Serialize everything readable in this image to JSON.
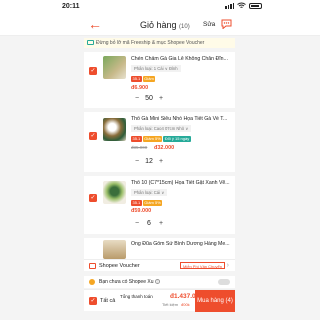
{
  "status_bar": {
    "time": "20:11"
  },
  "header": {
    "title": "Giỏ hàng",
    "count": "(10)",
    "edit_label": "Sửa"
  },
  "banner": {
    "text": "Đừng bỏ lỡ mã Freeship & mục Shopee Voucher"
  },
  "items": [
    {
      "name": "Chén Chấm Gà Gia Lê Không Chân Đĩn...",
      "variant": "Phân loại: 1 Cái ∨ Đỉnh",
      "old_price": "",
      "price": "đ6.900",
      "quantity": "50",
      "badges": []
    },
    {
      "name": "Thố Gà Mini Siêu Nhỏ Họa Tiết Gà Về T...",
      "variant": "Phân loại: Cao4 07cm Nhỏ ∨",
      "old_price": "đ35.000",
      "price": "đ32.000",
      "quantity": "12",
      "badges": [
        "35.1",
        "Giảm 5%",
        "Đổi ý 15 ngày"
      ]
    },
    {
      "name": "Thố 10 (C7*15cm) Họa Tiết Gật Xanh Vẽ...",
      "variant": "Phân loại: Cái ∨",
      "old_price": "",
      "price": "đ59.000",
      "quantity": "6",
      "badges": [
        "35.1",
        "Giảm 5%"
      ]
    },
    {
      "name": "Ống Đũa Gốm Sứ Bình Dương Hàng Me...",
      "variant": "",
      "old_price": "",
      "price": "",
      "quantity": "",
      "badges": []
    }
  ],
  "voucher": {
    "label": "Shopee Voucher",
    "link": "Miễn Phí Vận Chuyển"
  },
  "xu": {
    "label": "Bạn chưa có Shopee Xu",
    "help": "?"
  },
  "footer": {
    "select_all": "Tất cả",
    "total_label": "Tổng thanh toán",
    "total": "đ1.437.000",
    "save_label": "Tiết kiệm",
    "saved": "đ00k",
    "buy_label": "Mua hàng (4)"
  },
  "colors": {
    "accent": "#ee4d2d",
    "gold": "#f5a623",
    "green": "#26aa99"
  }
}
